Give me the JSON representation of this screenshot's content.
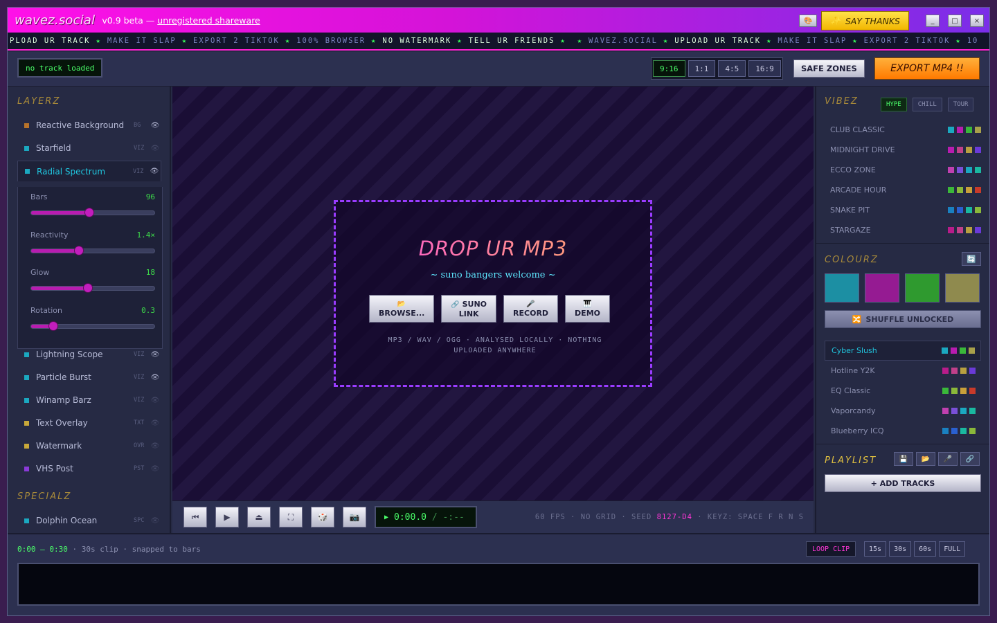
{
  "titlebar": {
    "logo": "wavez.social",
    "version": "v0.9 beta —",
    "shareware": "unregistered shareware",
    "palette_icon": "palette-icon",
    "thanks_label": "SAY THANKS",
    "thanks_icon": "✨",
    "min": "_",
    "max": "□",
    "close": "×"
  },
  "ticker": [
    {
      "text": "PLOAD UR TRACK",
      "hi": true
    },
    {
      "text": "MAKE IT SLAP",
      "hi": false
    },
    {
      "text": "EXPORT 2 TIKTOK",
      "hi": false
    },
    {
      "text": "100% BROWSER",
      "hi": false
    },
    {
      "text": "NO WATERMARK",
      "hi": true
    },
    {
      "text": "TELL UR FRIENDS",
      "hi": true
    },
    {
      "text": "",
      "hi": false
    },
    {
      "text": "WAVEZ.SOCIAL",
      "hi": false
    },
    {
      "text": "UPLOAD UR TRACK",
      "hi": true
    },
    {
      "text": "MAKE IT SLAP",
      "hi": false
    },
    {
      "text": "EXPORT 2 TIKTOK",
      "hi": false
    },
    {
      "text": "10",
      "hi": false
    }
  ],
  "toolbar": {
    "track_status": "no track loaded",
    "ratios": [
      "9:16",
      "1:1",
      "4:5",
      "16:9"
    ],
    "active_ratio": "9:16",
    "safe_zones": "SAFE ZONES",
    "export": "EXPORT MP4 !!"
  },
  "left": {
    "layers_title": "LAYERZ",
    "layers": [
      {
        "name": "Reactive Background",
        "tag": "BG",
        "color": "#b8732a",
        "eye": true
      },
      {
        "name": "Starfield",
        "tag": "VIZ",
        "color": "#1ba8c0",
        "eye": false
      },
      {
        "name": "Radial Spectrum",
        "tag": "VIZ",
        "color": "#1ba8c0",
        "eye": true,
        "selected": true
      },
      {
        "name": "Lightning Scope",
        "tag": "VIZ",
        "color": "#1ba8c0",
        "eye": true
      },
      {
        "name": "Particle Burst",
        "tag": "VIZ",
        "color": "#1ba8c0",
        "eye": true
      },
      {
        "name": "Winamp Barz",
        "tag": "VIZ",
        "color": "#1ba8c0",
        "eye": false
      },
      {
        "name": "Text Overlay",
        "tag": "TXT",
        "color": "#c8a83a",
        "eye": false
      },
      {
        "name": "Watermark",
        "tag": "OVR",
        "color": "#c8a83a",
        "eye": false
      },
      {
        "name": "VHS Post",
        "tag": "PST",
        "color": "#8a3ad8",
        "eye": false
      }
    ],
    "params": [
      {
        "label": "Bars",
        "value": "96",
        "fraction": 0.47
      },
      {
        "label": "Reactivity",
        "value": "1.4×",
        "fraction": 0.39
      },
      {
        "label": "Glow",
        "value": "18",
        "fraction": 0.46
      },
      {
        "label": "Rotation",
        "value": "0.3",
        "fraction": 0.18
      }
    ],
    "specials_title": "SPECIALZ",
    "specials": [
      {
        "name": "Dolphin Ocean",
        "tag": "SPC",
        "color": "#1ba8c0",
        "eye": false
      }
    ]
  },
  "stage": {
    "drop_title": "DROP UR MP3",
    "drop_sub": "~ suno bangers welcome ~",
    "buttons": [
      {
        "icon": "📂",
        "label": "BROWSE...",
        "name": "browse-button",
        "iname": "folder-icon"
      },
      {
        "icon": "🔗",
        "label_top": "SUNO",
        "label": "LINK",
        "name": "suno-link-button",
        "iname": "link-icon"
      },
      {
        "icon": "🎤",
        "label": "RECORD",
        "name": "record-button",
        "iname": "mic-icon"
      },
      {
        "icon": "🎹",
        "label": "DEMO",
        "name": "demo-button",
        "iname": "piano-icon"
      }
    ],
    "note_line1": "MP3 / WAV / OGG · ANALYSED LOCALLY · NOTHING",
    "note_line2": "UPLOADED ANYWHERE"
  },
  "transport": {
    "time": "0:00.0",
    "duration": "/ -:--",
    "status_pre": "60 FPS · NO GRID · SEED",
    "seed": "8127-D4",
    "status_post": "· KEYZ: SPACE F R N S"
  },
  "right": {
    "vibes_title": "VIBEZ",
    "vibe_tabs": [
      "HYPE",
      "CHILL",
      "TOUR"
    ],
    "active_vibe_tab": "HYPE",
    "vibes": [
      {
        "name": "CLUB CLASSIC",
        "colors": [
          "#1ba8c0",
          "#b81cb0",
          "#3ab83a",
          "#a8a04a"
        ]
      },
      {
        "name": "MIDNIGHT DRIVE",
        "colors": [
          "#b81cb0",
          "#c0408a",
          "#b8a040",
          "#6a3ad8"
        ]
      },
      {
        "name": "ECCO ZONE",
        "colors": [
          "#c040b0",
          "#7a50d8",
          "#1ba8c0",
          "#1ab8a0"
        ]
      },
      {
        "name": "ARCADE HOUR",
        "colors": [
          "#3ab83a",
          "#8ab83a",
          "#c8a03a",
          "#c83a2a"
        ]
      },
      {
        "name": "SNAKE PIT",
        "colors": [
          "#1a80c0",
          "#2a60d0",
          "#1ab8a0",
          "#8ab83a"
        ]
      },
      {
        "name": "STARGAZE",
        "colors": [
          "#b81c8a",
          "#c0408a",
          "#b8a040",
          "#6a3ad8"
        ]
      }
    ],
    "colours_title": "COLOURZ",
    "big_swatches": [
      "#1c8fa3",
      "#951b92",
      "#2f9a2f",
      "#8f8a4e"
    ],
    "shuffle_label": "SHUFFLE UNLOCKED",
    "palettes": [
      {
        "name": "Cyber Slush",
        "colors": [
          "#1ba8c0",
          "#b81cb0",
          "#3ab83a",
          "#a8a04a"
        ],
        "active": true
      },
      {
        "name": "Hotline Y2K",
        "colors": [
          "#b81c8a",
          "#c0408a",
          "#b8a040",
          "#6a3ad8"
        ]
      },
      {
        "name": "EQ Classic",
        "colors": [
          "#3ab83a",
          "#8ab83a",
          "#c8a03a",
          "#c83a2a"
        ]
      },
      {
        "name": "Vaporcandy",
        "colors": [
          "#c040b0",
          "#7a50d8",
          "#1ba8c0",
          "#1ab8a0"
        ]
      },
      {
        "name": "Blueberry ICQ",
        "colors": [
          "#1a80c0",
          "#2a60d0",
          "#1ab8a0",
          "#8ab83a"
        ]
      }
    ],
    "playlist_title": "PLAYLIST",
    "add_tracks": "+ ADD TRACKS"
  },
  "timeline": {
    "range": "0:00 – 0:30",
    "range_note": "· 30s clip · snapped to bars",
    "loop": "LOOP CLIP",
    "clips": [
      "15s",
      "30s",
      "60s",
      "FULL"
    ]
  }
}
